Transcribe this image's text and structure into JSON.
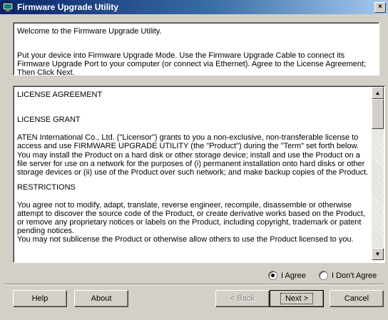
{
  "window": {
    "title": "Firmware Upgrade Utility",
    "close_label": "×"
  },
  "welcome": {
    "line1": "Welcome to the Firmware Upgrade Utility.",
    "line2": "Put your device into Firmware Upgrade Mode. Use the Firmware Upgrade Cable to connect its Firmware Upgrade Port to your computer (or connect via Ethernet). Agree to the License Agreement; Then Click Next."
  },
  "license": {
    "heading": "LICENSE AGREEMENT",
    "grant_heading": "LICENSE GRANT",
    "grant_p1": "ATEN International Co., Ltd. (\"Licensor\") grants to you a non-exclusive, non-transferable license to access and use FIRMWARE UPGRADE UTILITY (the \"Product\") during the \"Term\" set forth below.",
    "grant_p2": "You may install the Product on a hard disk or other storage device; install and use the Product on a file server for use on a network for the purposes of (i) permanent installation onto hard disks or other storage devices or (ii) use of the Product over such network; and make backup copies of the Product.",
    "restrictions_heading": "RESTRICTIONS",
    "restrictions_p1": "You agree not to modify, adapt, translate, reverse engineer, recompile, disassemble or otherwise attempt to discover the source code of the Product, or create derivative works based on the Product, or remove any proprietary notices or labels on the Product, including copyright, trademark or patent pending notices.",
    "restrictions_p2": "You may not sublicense the Product or otherwise allow others to use the Product licensed to you."
  },
  "agreement": {
    "agree_label": "I Agree",
    "disagree_label": "I Don't Agree",
    "selected": "agree"
  },
  "buttons": {
    "help": "Help",
    "about": "About",
    "back": "< Back",
    "next": "Next >",
    "cancel": "Cancel"
  }
}
